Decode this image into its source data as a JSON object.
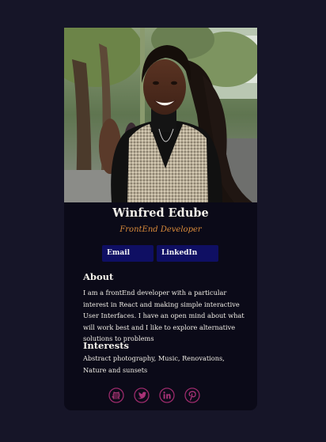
{
  "profile": {
    "name": "Winfred Edube",
    "role": "FrontEnd Developer"
  },
  "buttons": {
    "email_label": "Email",
    "linkedin_label": "LinkedIn"
  },
  "about": {
    "heading": "About",
    "text": "I am a frontEnd developer with a particular interest in React and making simple interactive User Interfaces. I have an open mind about what will work best and I like to explore alternative solutions to problems"
  },
  "interests": {
    "heading": "Interests",
    "text": "Abstract photography, Music, Renovations, Nature and sunsets"
  },
  "social_icons": [
    "github-icon",
    "twitter-icon",
    "linkedin-icon",
    "pinterest-icon"
  ],
  "colors": {
    "page_background": "#161528",
    "card_background": "#0b0a18",
    "accent_orange": "#d98a3a",
    "button_navy": "#0f0f63",
    "icon_pink": "#9a2a6a"
  }
}
